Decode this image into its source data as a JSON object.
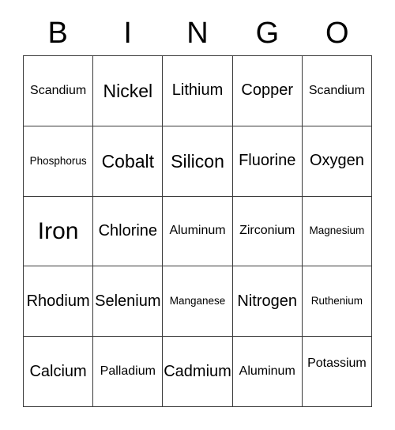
{
  "card": {
    "header": {
      "letters": [
        "B",
        "I",
        "N",
        "G",
        "O"
      ]
    },
    "rows": [
      [
        {
          "label": "Scandium",
          "size": "fs-sm"
        },
        {
          "label": "Nickel",
          "size": "fs-lg"
        },
        {
          "label": "Lithium",
          "size": "fs-md"
        },
        {
          "label": "Copper",
          "size": "fs-md"
        },
        {
          "label": "Scandium",
          "size": "fs-sm"
        }
      ],
      [
        {
          "label": "Phosphorus",
          "size": "fs-xs"
        },
        {
          "label": "Cobalt",
          "size": "fs-lg"
        },
        {
          "label": "Silicon",
          "size": "fs-lg"
        },
        {
          "label": "Fluorine",
          "size": "fs-md"
        },
        {
          "label": "Oxygen",
          "size": "fs-md"
        }
      ],
      [
        {
          "label": "Iron",
          "size": "fs-xl"
        },
        {
          "label": "Chlorine",
          "size": "fs-md"
        },
        {
          "label": "Aluminum",
          "size": "fs-sm"
        },
        {
          "label": "Zirconium",
          "size": "fs-sm"
        },
        {
          "label": "Magnesium",
          "size": "fs-xs"
        }
      ],
      [
        {
          "label": "Rhodium",
          "size": "fs-md"
        },
        {
          "label": "Selenium",
          "size": "fs-md"
        },
        {
          "label": "Manganese",
          "size": "fs-xs"
        },
        {
          "label": "Nitrogen",
          "size": "fs-md"
        },
        {
          "label": "Ruthenium",
          "size": "fs-xs"
        }
      ],
      [
        {
          "label": "Calcium",
          "size": "fs-md"
        },
        {
          "label": "Palladium",
          "size": "fs-sm"
        },
        {
          "label": "Cadmium",
          "size": "fs-md"
        },
        {
          "label": "Aluminum",
          "size": "fs-sm"
        },
        {
          "label": "Potassium",
          "size": "fs-sm",
          "align": "high"
        }
      ]
    ]
  },
  "colors": {
    "border": "#3a3a3a",
    "text": "#000000",
    "background": "#ffffff"
  }
}
